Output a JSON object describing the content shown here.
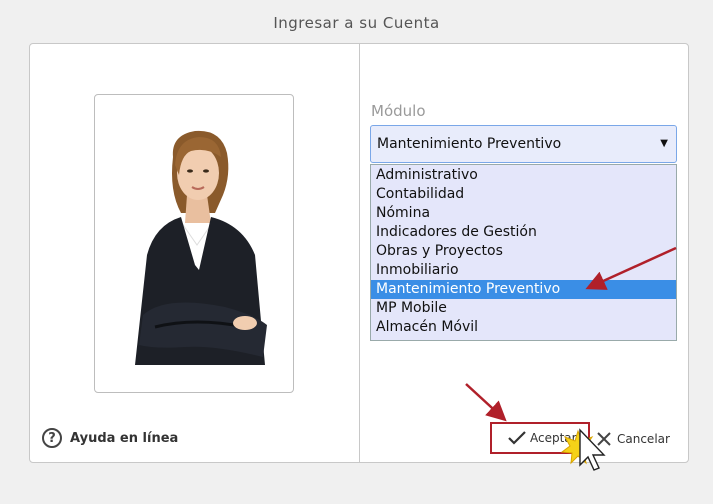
{
  "dialog": {
    "title": "Ingresar a su Cuenta"
  },
  "help": {
    "label": "Ayuda en línea",
    "icon": "question-circle-icon"
  },
  "module": {
    "label": "Módulo",
    "selected": "Mantenimiento Preventivo",
    "options": [
      "Administrativo",
      "Contabilidad",
      "Nómina",
      "Indicadores de Gestión",
      "Obras y Proyectos",
      "Inmobiliario",
      "Mantenimiento Preventivo",
      "MP Mobile",
      "Almacén Móvil"
    ],
    "selected_index": 6
  },
  "buttons": {
    "accept_label": "Aceptar",
    "cancel_label": "Cancelar"
  },
  "colors": {
    "highlight": "#3a8ee6",
    "annotation": "#b0202a",
    "dropdown_bg": "#e4e6fa"
  }
}
